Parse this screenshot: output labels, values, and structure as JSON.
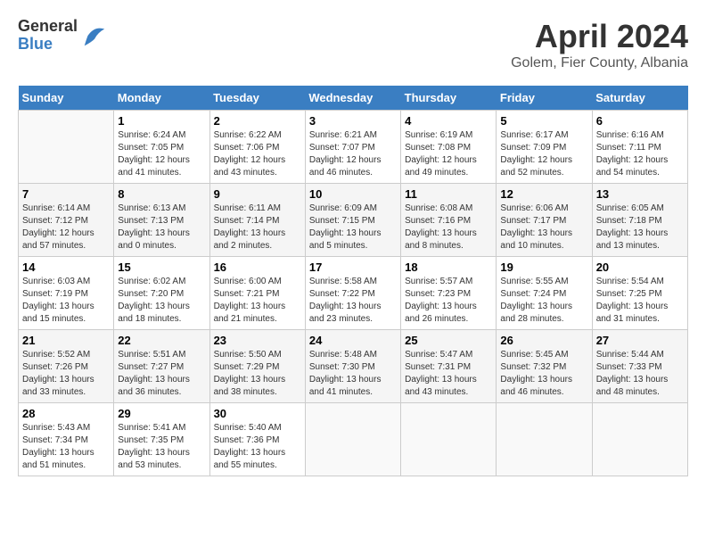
{
  "logo": {
    "general": "General",
    "blue": "Blue"
  },
  "title": "April 2024",
  "location": "Golem, Fier County, Albania",
  "days_of_week": [
    "Sunday",
    "Monday",
    "Tuesday",
    "Wednesday",
    "Thursday",
    "Friday",
    "Saturday"
  ],
  "weeks": [
    [
      {
        "day": "",
        "info": ""
      },
      {
        "day": "1",
        "info": "Sunrise: 6:24 AM\nSunset: 7:05 PM\nDaylight: 12 hours\nand 41 minutes."
      },
      {
        "day": "2",
        "info": "Sunrise: 6:22 AM\nSunset: 7:06 PM\nDaylight: 12 hours\nand 43 minutes."
      },
      {
        "day": "3",
        "info": "Sunrise: 6:21 AM\nSunset: 7:07 PM\nDaylight: 12 hours\nand 46 minutes."
      },
      {
        "day": "4",
        "info": "Sunrise: 6:19 AM\nSunset: 7:08 PM\nDaylight: 12 hours\nand 49 minutes."
      },
      {
        "day": "5",
        "info": "Sunrise: 6:17 AM\nSunset: 7:09 PM\nDaylight: 12 hours\nand 52 minutes."
      },
      {
        "day": "6",
        "info": "Sunrise: 6:16 AM\nSunset: 7:11 PM\nDaylight: 12 hours\nand 54 minutes."
      }
    ],
    [
      {
        "day": "7",
        "info": "Sunrise: 6:14 AM\nSunset: 7:12 PM\nDaylight: 12 hours\nand 57 minutes."
      },
      {
        "day": "8",
        "info": "Sunrise: 6:13 AM\nSunset: 7:13 PM\nDaylight: 13 hours\nand 0 minutes."
      },
      {
        "day": "9",
        "info": "Sunrise: 6:11 AM\nSunset: 7:14 PM\nDaylight: 13 hours\nand 2 minutes."
      },
      {
        "day": "10",
        "info": "Sunrise: 6:09 AM\nSunset: 7:15 PM\nDaylight: 13 hours\nand 5 minutes."
      },
      {
        "day": "11",
        "info": "Sunrise: 6:08 AM\nSunset: 7:16 PM\nDaylight: 13 hours\nand 8 minutes."
      },
      {
        "day": "12",
        "info": "Sunrise: 6:06 AM\nSunset: 7:17 PM\nDaylight: 13 hours\nand 10 minutes."
      },
      {
        "day": "13",
        "info": "Sunrise: 6:05 AM\nSunset: 7:18 PM\nDaylight: 13 hours\nand 13 minutes."
      }
    ],
    [
      {
        "day": "14",
        "info": "Sunrise: 6:03 AM\nSunset: 7:19 PM\nDaylight: 13 hours\nand 15 minutes."
      },
      {
        "day": "15",
        "info": "Sunrise: 6:02 AM\nSunset: 7:20 PM\nDaylight: 13 hours\nand 18 minutes."
      },
      {
        "day": "16",
        "info": "Sunrise: 6:00 AM\nSunset: 7:21 PM\nDaylight: 13 hours\nand 21 minutes."
      },
      {
        "day": "17",
        "info": "Sunrise: 5:58 AM\nSunset: 7:22 PM\nDaylight: 13 hours\nand 23 minutes."
      },
      {
        "day": "18",
        "info": "Sunrise: 5:57 AM\nSunset: 7:23 PM\nDaylight: 13 hours\nand 26 minutes."
      },
      {
        "day": "19",
        "info": "Sunrise: 5:55 AM\nSunset: 7:24 PM\nDaylight: 13 hours\nand 28 minutes."
      },
      {
        "day": "20",
        "info": "Sunrise: 5:54 AM\nSunset: 7:25 PM\nDaylight: 13 hours\nand 31 minutes."
      }
    ],
    [
      {
        "day": "21",
        "info": "Sunrise: 5:52 AM\nSunset: 7:26 PM\nDaylight: 13 hours\nand 33 minutes."
      },
      {
        "day": "22",
        "info": "Sunrise: 5:51 AM\nSunset: 7:27 PM\nDaylight: 13 hours\nand 36 minutes."
      },
      {
        "day": "23",
        "info": "Sunrise: 5:50 AM\nSunset: 7:29 PM\nDaylight: 13 hours\nand 38 minutes."
      },
      {
        "day": "24",
        "info": "Sunrise: 5:48 AM\nSunset: 7:30 PM\nDaylight: 13 hours\nand 41 minutes."
      },
      {
        "day": "25",
        "info": "Sunrise: 5:47 AM\nSunset: 7:31 PM\nDaylight: 13 hours\nand 43 minutes."
      },
      {
        "day": "26",
        "info": "Sunrise: 5:45 AM\nSunset: 7:32 PM\nDaylight: 13 hours\nand 46 minutes."
      },
      {
        "day": "27",
        "info": "Sunrise: 5:44 AM\nSunset: 7:33 PM\nDaylight: 13 hours\nand 48 minutes."
      }
    ],
    [
      {
        "day": "28",
        "info": "Sunrise: 5:43 AM\nSunset: 7:34 PM\nDaylight: 13 hours\nand 51 minutes."
      },
      {
        "day": "29",
        "info": "Sunrise: 5:41 AM\nSunset: 7:35 PM\nDaylight: 13 hours\nand 53 minutes."
      },
      {
        "day": "30",
        "info": "Sunrise: 5:40 AM\nSunset: 7:36 PM\nDaylight: 13 hours\nand 55 minutes."
      },
      {
        "day": "",
        "info": ""
      },
      {
        "day": "",
        "info": ""
      },
      {
        "day": "",
        "info": ""
      },
      {
        "day": "",
        "info": ""
      }
    ]
  ]
}
